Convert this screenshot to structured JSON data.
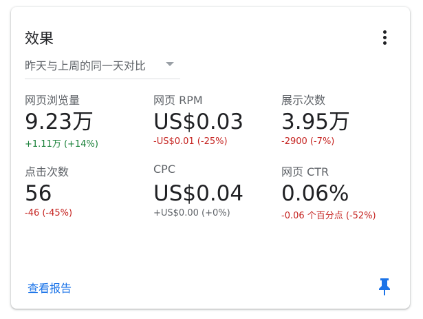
{
  "card": {
    "title": "效果",
    "compare_label": "昨天与上周的同一天对比",
    "report_link": "查看报告",
    "accent_color": "#1a73e8",
    "positive_color": "#188038",
    "negative_color": "#c5221f",
    "icons": [
      "more-vert-icon",
      "dropdown-caret-icon",
      "pin-icon"
    ]
  },
  "metrics": [
    {
      "label": "网页浏览量",
      "value": "9.23万",
      "delta": "+1.11万 (+14%)",
      "trend": "positive"
    },
    {
      "label": "网页 RPM",
      "value": "US$0.03",
      "delta": "-US$0.01 (-25%)",
      "trend": "negative"
    },
    {
      "label": "展示次数",
      "value": "3.95万",
      "delta": "-2900 (-7%)",
      "trend": "negative"
    },
    {
      "label": "点击次数",
      "value": "56",
      "delta": "-46 (-45%)",
      "trend": "negative"
    },
    {
      "label": "CPC",
      "value": "US$0.04",
      "delta": "+US$0.00 (+0%)",
      "trend": "neutral"
    },
    {
      "label": "网页 CTR",
      "value": "0.06%",
      "delta": "-0.06 个百分点 (-52%)",
      "trend": "negative"
    }
  ]
}
